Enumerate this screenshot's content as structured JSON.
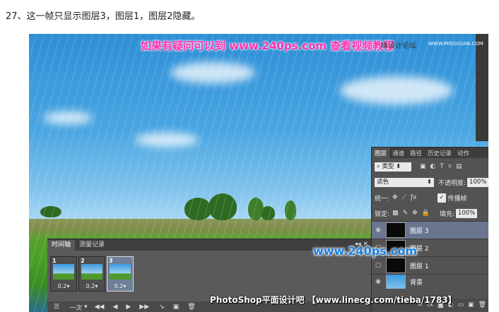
{
  "caption": "27、这一帧只显示图层3，图层1，图层2隐藏。",
  "watermarks": {
    "top": "如果有疑问可以到 www.240ps.com 查看视频教程",
    "top_right": "缘设计论坛",
    "top_site": "WWW.MISSVUAN.COM",
    "middle": "www.240ps.com",
    "bottom": "PhotoShop平面设计吧 【www.linecg.com/tieba/1783】"
  },
  "timeline": {
    "tabs": [
      "时间轴",
      "测量记录"
    ],
    "controls": "◂◂ ✕",
    "frames": [
      {
        "num": "1",
        "duration": "0.2▾",
        "selected": false
      },
      {
        "num": "2",
        "duration": "0.2▾",
        "selected": false
      },
      {
        "num": "3",
        "duration": "0.2▾",
        "selected": true
      }
    ],
    "toolbar": {
      "menu_icon": "☰",
      "loop": "一次",
      "loop_arrow": "▾",
      "first": "◀◀",
      "prev": "◀",
      "play": "▶",
      "next": "▶▶",
      "tween": "↘",
      "new_frame": "▣",
      "delete": "🗑"
    }
  },
  "layers_panel": {
    "tabs": [
      "图层",
      "通道",
      "路径",
      "历史记录",
      "动作"
    ],
    "filter_kind": "类型",
    "filter_icons": [
      "▣",
      "◐",
      "T",
      "⌗",
      "▤"
    ],
    "blend_mode": "滤色",
    "opacity_label": "不透明度:",
    "opacity_value": "100%",
    "unify_label": "统一:",
    "unify_icons": [
      "✥",
      "⟋",
      "ƒx"
    ],
    "propagate_check": "✓",
    "propagate_label": "传播帧",
    "lock_label": "锁定:",
    "lock_icons": [
      "▩",
      "✎",
      "✥",
      "🔒"
    ],
    "fill_label": "填充:",
    "fill_value": "100%",
    "layers": [
      {
        "name": "图层 3",
        "visible": true,
        "selected": true
      },
      {
        "name": "图层 2",
        "visible": false,
        "selected": false
      },
      {
        "name": "图层 1",
        "visible": false,
        "selected": false
      },
      {
        "name": "背景",
        "visible": true,
        "selected": false
      }
    ],
    "bottom_icons": [
      "∞",
      "fx",
      "◙",
      "◐",
      "▭",
      "▣",
      "🗑"
    ]
  }
}
